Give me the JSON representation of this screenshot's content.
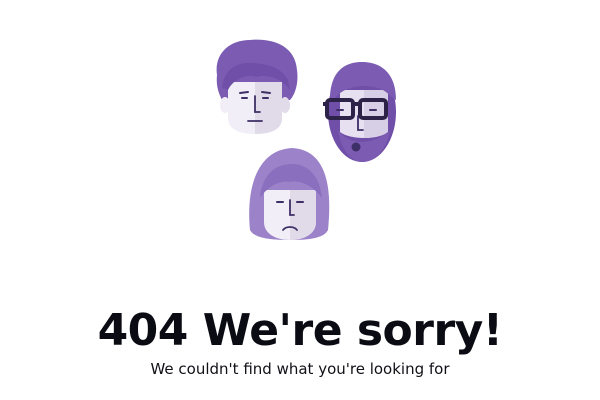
{
  "error": {
    "heading": "404 We're sorry!",
    "message": "We couldn't find what you're looking for"
  },
  "illustration": {
    "icons": [
      "man-curly-hair-face-icon",
      "man-glasses-beard-face-icon",
      "woman-sad-face-icon"
    ],
    "colors": {
      "purple_dark": "#6f4fa7",
      "purple_mid": "#7c5cb3",
      "purple_light": "#9b82c9",
      "skin": "#f1eef8",
      "skin_shadow": "#ddd6eb",
      "outline": "#3e2f66"
    }
  }
}
